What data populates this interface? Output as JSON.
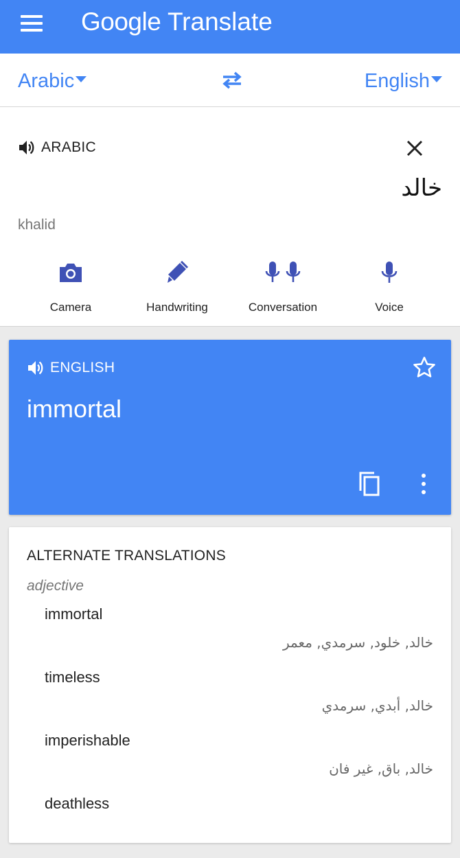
{
  "appbar": {
    "title_brand": "Google",
    "title_product": "Translate"
  },
  "languages": {
    "source": "Arabic",
    "target": "English"
  },
  "input": {
    "language_label": "ARABIC",
    "text": "خالد",
    "transliteration": "khalid"
  },
  "tools": {
    "camera": "Camera",
    "handwriting": "Handwriting",
    "conversation": "Conversation",
    "voice": "Voice"
  },
  "result": {
    "language_label": "ENGLISH",
    "text": "immortal"
  },
  "alternates": {
    "title": "ALTERNATE TRANSLATIONS",
    "part_of_speech": "adjective",
    "items": [
      {
        "word": "immortal",
        "back": "خالد, خلود, سرمدي, معمر"
      },
      {
        "word": "timeless",
        "back": "خالد, أبدي, سرمدي"
      },
      {
        "word": "imperishable",
        "back": "خالد, باق, غير فان"
      },
      {
        "word": "deathless",
        "back": ""
      }
    ]
  },
  "colors": {
    "accent": "#4285f4",
    "icon_indigo": "#3f51b5"
  }
}
